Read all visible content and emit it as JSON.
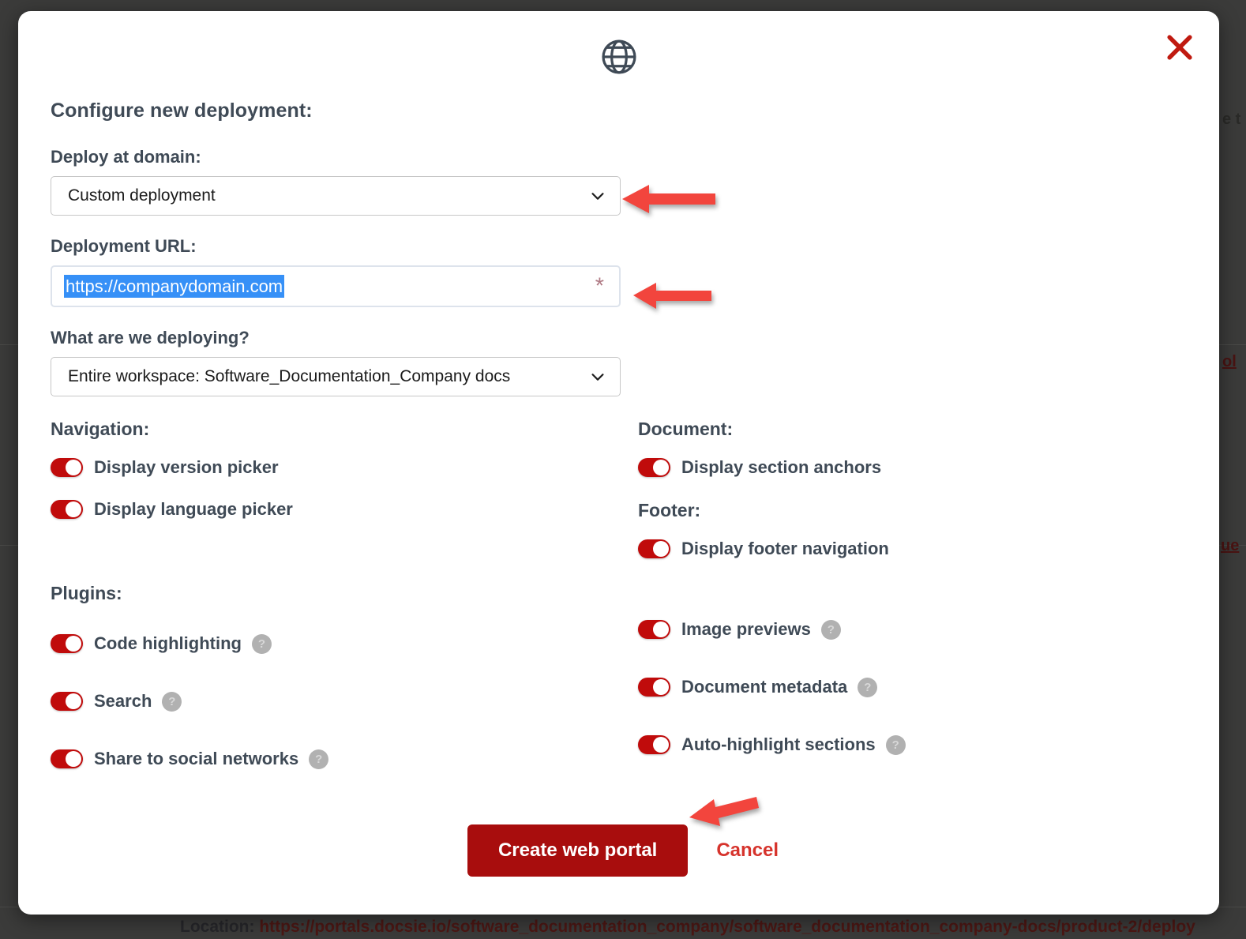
{
  "modal": {
    "icon": "globe-icon",
    "close_icon": "close-icon",
    "title": "Configure new deployment:",
    "domain_field": {
      "label": "Deploy at domain:",
      "value": "Custom deployment",
      "chevron": "chevron-down-icon"
    },
    "url_field": {
      "label": "Deployment URL:",
      "value": "https://companydomain.com",
      "required_marker": "*"
    },
    "target_field": {
      "label": "What are we deploying?",
      "value": "Entire workspace: Software_Documentation_Company docs",
      "chevron": "chevron-down-icon"
    },
    "navigation": {
      "heading": "Navigation:",
      "toggles": [
        {
          "label": "Display version picker",
          "on": true
        },
        {
          "label": "Display language picker",
          "on": true
        }
      ]
    },
    "document": {
      "heading": "Document:",
      "toggles": [
        {
          "label": "Display section anchors",
          "on": true
        }
      ]
    },
    "footer": {
      "heading": "Footer:",
      "toggles": [
        {
          "label": "Display footer navigation",
          "on": true
        }
      ]
    },
    "plugins": {
      "heading": "Plugins:",
      "left": [
        {
          "label": "Code highlighting",
          "on": true,
          "help": "?"
        },
        {
          "label": "Search",
          "on": true,
          "help": "?"
        },
        {
          "label": "Share to social networks",
          "on": true,
          "help": "?"
        }
      ],
      "right": [
        {
          "label": "Image previews",
          "on": true,
          "help": "?"
        },
        {
          "label": "Document metadata",
          "on": true,
          "help": "?"
        },
        {
          "label": "Auto-highlight sections",
          "on": true,
          "help": "?"
        }
      ]
    },
    "actions": {
      "primary": "Create web portal",
      "secondary": "Cancel"
    }
  },
  "background": {
    "location_label": "Location:",
    "location_url": "https://portals.docsie.io/software_documentation_company/software_documentation_company-docs/product-2/deploy",
    "fragments": [
      {
        "text": "e t",
        "link": false
      },
      {
        "text": "ol",
        "link": true
      },
      {
        "text": "ue",
        "link": true
      }
    ]
  },
  "colors": {
    "accent_red": "#c00b0b",
    "primary_button": "#a80d0d",
    "cancel_link": "#d6332c",
    "arrow": "#f2453d",
    "selection_blue": "#3690f7",
    "label_slate": "#3f4a56",
    "overlay": "#3b3b3a"
  }
}
